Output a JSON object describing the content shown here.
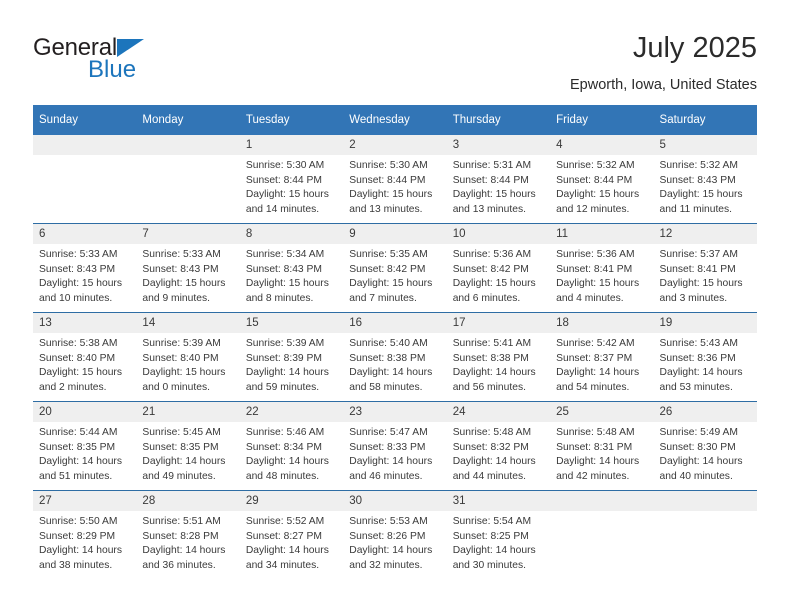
{
  "brand": {
    "name_top": "General",
    "name_bottom": "Blue",
    "color_primary": "#1c75bc",
    "triangle_icon": "triangle-icon"
  },
  "header": {
    "title": "July 2025",
    "subtitle": "Epworth, Iowa, United States"
  },
  "calendar": {
    "header_bg": "#3275b6",
    "header_text_color": "#ffffff",
    "daynum_bg": "#efefef",
    "row_divider_color": "#2e6da4",
    "weekday_headers": [
      "Sunday",
      "Monday",
      "Tuesday",
      "Wednesday",
      "Thursday",
      "Friday",
      "Saturday"
    ],
    "weeks": [
      [
        {
          "day": "",
          "sunrise": "",
          "sunset": "",
          "daylight_line1": "",
          "daylight_line2": ""
        },
        {
          "day": "",
          "sunrise": "",
          "sunset": "",
          "daylight_line1": "",
          "daylight_line2": ""
        },
        {
          "day": "1",
          "sunrise": "Sunrise: 5:30 AM",
          "sunset": "Sunset: 8:44 PM",
          "daylight_line1": "Daylight: 15 hours",
          "daylight_line2": "and 14 minutes."
        },
        {
          "day": "2",
          "sunrise": "Sunrise: 5:30 AM",
          "sunset": "Sunset: 8:44 PM",
          "daylight_line1": "Daylight: 15 hours",
          "daylight_line2": "and 13 minutes."
        },
        {
          "day": "3",
          "sunrise": "Sunrise: 5:31 AM",
          "sunset": "Sunset: 8:44 PM",
          "daylight_line1": "Daylight: 15 hours",
          "daylight_line2": "and 13 minutes."
        },
        {
          "day": "4",
          "sunrise": "Sunrise: 5:32 AM",
          "sunset": "Sunset: 8:44 PM",
          "daylight_line1": "Daylight: 15 hours",
          "daylight_line2": "and 12 minutes."
        },
        {
          "day": "5",
          "sunrise": "Sunrise: 5:32 AM",
          "sunset": "Sunset: 8:43 PM",
          "daylight_line1": "Daylight: 15 hours",
          "daylight_line2": "and 11 minutes."
        }
      ],
      [
        {
          "day": "6",
          "sunrise": "Sunrise: 5:33 AM",
          "sunset": "Sunset: 8:43 PM",
          "daylight_line1": "Daylight: 15 hours",
          "daylight_line2": "and 10 minutes."
        },
        {
          "day": "7",
          "sunrise": "Sunrise: 5:33 AM",
          "sunset": "Sunset: 8:43 PM",
          "daylight_line1": "Daylight: 15 hours",
          "daylight_line2": "and 9 minutes."
        },
        {
          "day": "8",
          "sunrise": "Sunrise: 5:34 AM",
          "sunset": "Sunset: 8:43 PM",
          "daylight_line1": "Daylight: 15 hours",
          "daylight_line2": "and 8 minutes."
        },
        {
          "day": "9",
          "sunrise": "Sunrise: 5:35 AM",
          "sunset": "Sunset: 8:42 PM",
          "daylight_line1": "Daylight: 15 hours",
          "daylight_line2": "and 7 minutes."
        },
        {
          "day": "10",
          "sunrise": "Sunrise: 5:36 AM",
          "sunset": "Sunset: 8:42 PM",
          "daylight_line1": "Daylight: 15 hours",
          "daylight_line2": "and 6 minutes."
        },
        {
          "day": "11",
          "sunrise": "Sunrise: 5:36 AM",
          "sunset": "Sunset: 8:41 PM",
          "daylight_line1": "Daylight: 15 hours",
          "daylight_line2": "and 4 minutes."
        },
        {
          "day": "12",
          "sunrise": "Sunrise: 5:37 AM",
          "sunset": "Sunset: 8:41 PM",
          "daylight_line1": "Daylight: 15 hours",
          "daylight_line2": "and 3 minutes."
        }
      ],
      [
        {
          "day": "13",
          "sunrise": "Sunrise: 5:38 AM",
          "sunset": "Sunset: 8:40 PM",
          "daylight_line1": "Daylight: 15 hours",
          "daylight_line2": "and 2 minutes."
        },
        {
          "day": "14",
          "sunrise": "Sunrise: 5:39 AM",
          "sunset": "Sunset: 8:40 PM",
          "daylight_line1": "Daylight: 15 hours",
          "daylight_line2": "and 0 minutes."
        },
        {
          "day": "15",
          "sunrise": "Sunrise: 5:39 AM",
          "sunset": "Sunset: 8:39 PM",
          "daylight_line1": "Daylight: 14 hours",
          "daylight_line2": "and 59 minutes."
        },
        {
          "day": "16",
          "sunrise": "Sunrise: 5:40 AM",
          "sunset": "Sunset: 8:38 PM",
          "daylight_line1": "Daylight: 14 hours",
          "daylight_line2": "and 58 minutes."
        },
        {
          "day": "17",
          "sunrise": "Sunrise: 5:41 AM",
          "sunset": "Sunset: 8:38 PM",
          "daylight_line1": "Daylight: 14 hours",
          "daylight_line2": "and 56 minutes."
        },
        {
          "day": "18",
          "sunrise": "Sunrise: 5:42 AM",
          "sunset": "Sunset: 8:37 PM",
          "daylight_line1": "Daylight: 14 hours",
          "daylight_line2": "and 54 minutes."
        },
        {
          "day": "19",
          "sunrise": "Sunrise: 5:43 AM",
          "sunset": "Sunset: 8:36 PM",
          "daylight_line1": "Daylight: 14 hours",
          "daylight_line2": "and 53 minutes."
        }
      ],
      [
        {
          "day": "20",
          "sunrise": "Sunrise: 5:44 AM",
          "sunset": "Sunset: 8:35 PM",
          "daylight_line1": "Daylight: 14 hours",
          "daylight_line2": "and 51 minutes."
        },
        {
          "day": "21",
          "sunrise": "Sunrise: 5:45 AM",
          "sunset": "Sunset: 8:35 PM",
          "daylight_line1": "Daylight: 14 hours",
          "daylight_line2": "and 49 minutes."
        },
        {
          "day": "22",
          "sunrise": "Sunrise: 5:46 AM",
          "sunset": "Sunset: 8:34 PM",
          "daylight_line1": "Daylight: 14 hours",
          "daylight_line2": "and 48 minutes."
        },
        {
          "day": "23",
          "sunrise": "Sunrise: 5:47 AM",
          "sunset": "Sunset: 8:33 PM",
          "daylight_line1": "Daylight: 14 hours",
          "daylight_line2": "and 46 minutes."
        },
        {
          "day": "24",
          "sunrise": "Sunrise: 5:48 AM",
          "sunset": "Sunset: 8:32 PM",
          "daylight_line1": "Daylight: 14 hours",
          "daylight_line2": "and 44 minutes."
        },
        {
          "day": "25",
          "sunrise": "Sunrise: 5:48 AM",
          "sunset": "Sunset: 8:31 PM",
          "daylight_line1": "Daylight: 14 hours",
          "daylight_line2": "and 42 minutes."
        },
        {
          "day": "26",
          "sunrise": "Sunrise: 5:49 AM",
          "sunset": "Sunset: 8:30 PM",
          "daylight_line1": "Daylight: 14 hours",
          "daylight_line2": "and 40 minutes."
        }
      ],
      [
        {
          "day": "27",
          "sunrise": "Sunrise: 5:50 AM",
          "sunset": "Sunset: 8:29 PM",
          "daylight_line1": "Daylight: 14 hours",
          "daylight_line2": "and 38 minutes."
        },
        {
          "day": "28",
          "sunrise": "Sunrise: 5:51 AM",
          "sunset": "Sunset: 8:28 PM",
          "daylight_line1": "Daylight: 14 hours",
          "daylight_line2": "and 36 minutes."
        },
        {
          "day": "29",
          "sunrise": "Sunrise: 5:52 AM",
          "sunset": "Sunset: 8:27 PM",
          "daylight_line1": "Daylight: 14 hours",
          "daylight_line2": "and 34 minutes."
        },
        {
          "day": "30",
          "sunrise": "Sunrise: 5:53 AM",
          "sunset": "Sunset: 8:26 PM",
          "daylight_line1": "Daylight: 14 hours",
          "daylight_line2": "and 32 minutes."
        },
        {
          "day": "31",
          "sunrise": "Sunrise: 5:54 AM",
          "sunset": "Sunset: 8:25 PM",
          "daylight_line1": "Daylight: 14 hours",
          "daylight_line2": "and 30 minutes."
        },
        {
          "day": "",
          "sunrise": "",
          "sunset": "",
          "daylight_line1": "",
          "daylight_line2": ""
        },
        {
          "day": "",
          "sunrise": "",
          "sunset": "",
          "daylight_line1": "",
          "daylight_line2": ""
        }
      ]
    ]
  }
}
